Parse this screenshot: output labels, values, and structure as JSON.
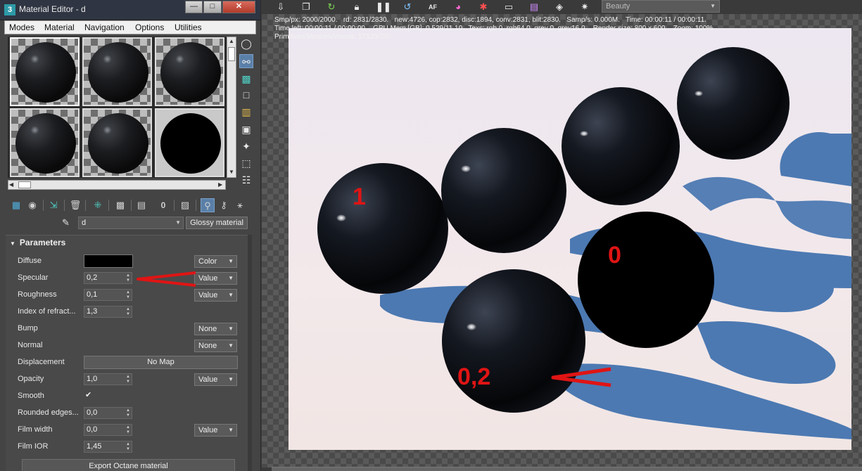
{
  "editor": {
    "app_icon": "3",
    "title": "Material Editor - d",
    "window_buttons": {
      "minimize": "—",
      "maximize": "□",
      "close": "✕"
    },
    "menu": [
      "Modes",
      "Material",
      "Navigation",
      "Options",
      "Utilities"
    ],
    "slots": [
      {
        "selected": true,
        "black": false
      },
      {
        "selected": false,
        "black": false
      },
      {
        "selected": false,
        "black": false
      },
      {
        "selected": false,
        "black": false
      },
      {
        "selected": false,
        "black": false
      },
      {
        "selected": false,
        "black": true
      }
    ],
    "side_tool_icons": [
      "sphere-icon",
      "backlight-icon",
      "checker-background-icon",
      "sample-uv-icon",
      "video-color-check-icon",
      "make-preview-icon",
      "options-icon",
      "select-by-material-icon",
      "material-navigator-icon"
    ],
    "toolbar_icons": [
      "get-material-icon",
      "put-to-scene-icon",
      "assign-to-selection-icon",
      "reset-map-icon",
      "make-unique-icon",
      "put-to-library-icon",
      "material-id-icon",
      "show-map-icon",
      "show-end-result-icon",
      "go-to-parent-icon",
      "go-forward-icon"
    ],
    "material_id_label": "0",
    "material_name": "d",
    "material_type": "Glossy material",
    "parameters_title": "Parameters",
    "params": [
      {
        "label": "Diffuse",
        "kind": "swatch",
        "color": "#000000",
        "dropdown": "Color"
      },
      {
        "label": "Specular",
        "kind": "spin",
        "value": "0,2",
        "dropdown": "Value"
      },
      {
        "label": "Roughness",
        "kind": "spin",
        "value": "0,1",
        "dropdown": "Value"
      },
      {
        "label": "Index of refract...",
        "kind": "spin",
        "value": "1,3"
      },
      {
        "label": "Bump",
        "kind": "none",
        "dropdown": "None"
      },
      {
        "label": "Normal",
        "kind": "none",
        "dropdown": "None"
      },
      {
        "label": "Displacement",
        "kind": "button",
        "button": "No Map"
      },
      {
        "label": "Opacity",
        "kind": "spin",
        "value": "1,0",
        "dropdown": "Value"
      },
      {
        "label": "Smooth",
        "kind": "check",
        "checked": true
      },
      {
        "label": "Rounded edges...",
        "kind": "spin",
        "value": "0,0"
      },
      {
        "label": "Film width",
        "kind": "spin",
        "value": "0,0",
        "dropdown": "Value"
      },
      {
        "label": "Film IOR",
        "kind": "spin",
        "value": "1,45"
      }
    ],
    "export_button": "Export Octane material"
  },
  "render": {
    "toolbar_icons": [
      "save-image-icon",
      "copy-icon",
      "restart-render-icon",
      "lock-icon",
      "pause-icon",
      "resume-icon",
      "af-icon",
      "color-picker-icon",
      "clay-mode-icon",
      "region-render-icon",
      "film-region-icon",
      "settings-icon",
      "gear-icon"
    ],
    "af_label": "AF",
    "pass_select": "Beauty",
    "stats_line1": "Smp/px: 2000/2000.   rd: 2831/2830.   new:4726, cop:2832, disc:1894, conv:2831, blit:2830.   Samp/s: 0.000M.   Time: 00:00:11 / 00:00:11.",
    "stats_line2": "Time left: 00:00:11 / 00:00:00.   GPU Mem [GB]: 0.529/11.10   Texs: rgb 0, rgb64 0, grey 0, grey16 0.   Render size: 800 x 600.   Zoom: 100%.",
    "stats_line3": "Primitives/Meshes/Voxels: 17120/7/0",
    "spheres": [
      {
        "label": "1",
        "kind": "glossy"
      },
      {
        "label": "",
        "kind": "glossy"
      },
      {
        "label": "",
        "kind": "glossy"
      },
      {
        "label": "",
        "kind": "glossy"
      },
      {
        "label": "0",
        "kind": "matte"
      },
      {
        "label": "0,2",
        "kind": "glossy"
      }
    ],
    "colors": {
      "shadow": "#4c79b2",
      "annotation": "#e01414",
      "background": "#ece8f0"
    }
  }
}
